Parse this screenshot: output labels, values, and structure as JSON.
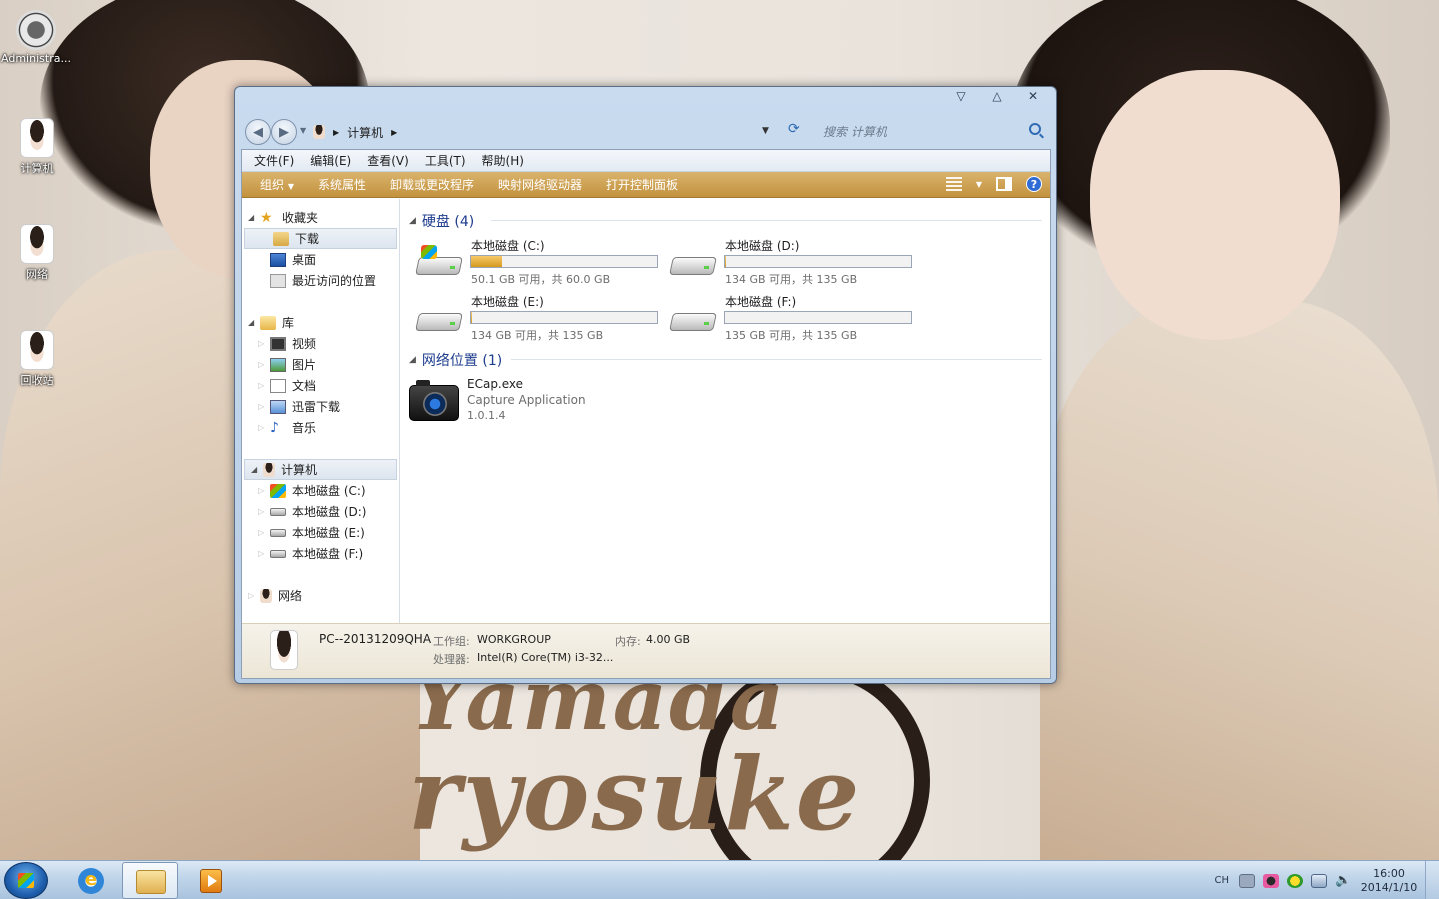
{
  "desktop": {
    "icons": [
      {
        "label": "Administra...",
        "icon": "webcam-icon"
      },
      {
        "label": "计算机",
        "icon": "person-photo-icon"
      },
      {
        "label": "网络",
        "icon": "person-photo-icon"
      },
      {
        "label": "回收站",
        "icon": "person-photo-icon"
      }
    ],
    "wallpaper_text": [
      "Yamada",
      "ryosuke"
    ]
  },
  "window": {
    "controls": [
      "minimize-icon",
      "maximize-icon",
      "close-icon"
    ],
    "address": {
      "segments": [
        "计算机"
      ],
      "search_placeholder": "搜索 计算机"
    },
    "menu": [
      "文件(F)",
      "编辑(E)",
      "查看(V)",
      "工具(T)",
      "帮助(H)"
    ],
    "commands": [
      "组织",
      "系统属性",
      "卸载或更改程序",
      "映射网络驱动器",
      "打开控制面板"
    ],
    "accent": "#c3923e",
    "nav": {
      "favorites": {
        "label": "收藏夹",
        "items": [
          "下载",
          "桌面",
          "最近访问的位置"
        ]
      },
      "libraries": {
        "label": "库",
        "items": [
          "视频",
          "图片",
          "文档",
          "迅雷下载",
          "音乐"
        ]
      },
      "computer": {
        "label": "计算机",
        "items": [
          "本地磁盘 (C:)",
          "本地磁盘 (D:)",
          "本地磁盘 (E:)",
          "本地磁盘 (F:)"
        ]
      },
      "network": {
        "label": "网络"
      }
    },
    "groups": {
      "hard_disks": {
        "title": "硬盘 (4)",
        "drives": [
          {
            "name": "本地磁盘 (C:)",
            "free": "50.1 GB 可用，共 60.0 GB",
            "used_fraction": 0.165
          },
          {
            "name": "本地磁盘 (D:)",
            "free": "134 GB 可用，共 135 GB",
            "used_fraction": 0.007
          },
          {
            "name": "本地磁盘 (E:)",
            "free": "134 GB 可用，共 135 GB",
            "used_fraction": 0.007
          },
          {
            "name": "本地磁盘 (F:)",
            "free": "135 GB 可用，共 135 GB",
            "used_fraction": 0.0
          }
        ]
      },
      "network_locations": {
        "title": "网络位置 (1)",
        "item": {
          "name": "ECap.exe",
          "desc": "Capture Application",
          "version": "1.0.1.4"
        }
      }
    },
    "details": {
      "pc_name": "PC--20131209QHA",
      "workgroup_label": "工作组:",
      "workgroup": "WORKGROUP",
      "memory_label": "内存:",
      "memory": "4.00 GB",
      "cpu_label": "处理器:",
      "cpu": "Intel(R) Core(TM) i3-32..."
    }
  },
  "taskbar": {
    "lang": "CH",
    "time": "16:00",
    "date": "2014/1/10"
  }
}
